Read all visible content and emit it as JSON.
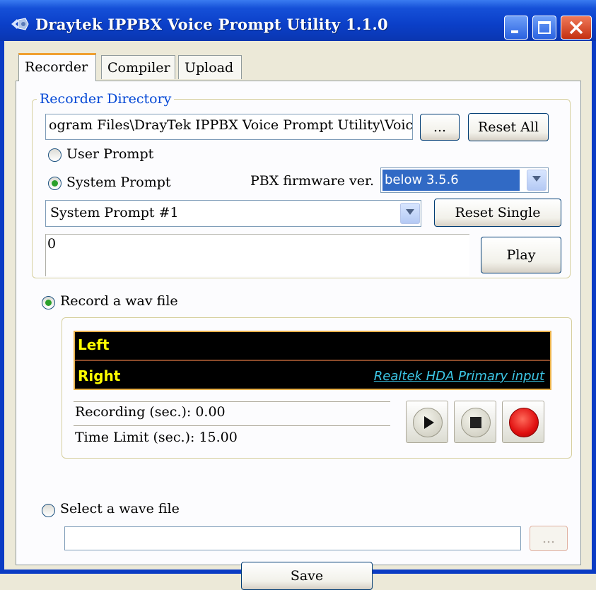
{
  "window": {
    "title": "Draytek IPPBX Voice Prompt Utility 1.1.0"
  },
  "tabs": [
    "Recorder",
    "Compiler",
    "Upload"
  ],
  "recorder_directory": {
    "legend": "Recorder Directory",
    "path": "ogram Files\\DrayTek IPPBX Voice Prompt Utility\\Voice",
    "browse_label": "...",
    "reset_all_label": "Reset All",
    "user_prompt_label": "User Prompt",
    "system_prompt_label": "System Prompt",
    "selected_prompt_type": "System Prompt",
    "firmware_label": "PBX firmware ver.",
    "firmware_value": "below 3.5.6",
    "prompt_select_value": "System Prompt #1",
    "reset_single_label": "Reset Single",
    "text_value": "0",
    "play_label": "Play"
  },
  "record": {
    "option_label": "Record a wav file",
    "selected": true,
    "left_label": "Left",
    "right_label": "Right",
    "input_source": "Realtek HDA Primary input",
    "recording_text": "Recording (sec.): 0.00",
    "time_limit_text": "Time Limit (sec.): 15.00"
  },
  "select_wave": {
    "option_label": "Select a wave file",
    "selected": false,
    "path": "",
    "browse_label": "..."
  },
  "save_label": "Save",
  "colors": {
    "title_bar": "#0a3bc4",
    "legend": "#0046d5",
    "meter_text": "#ffff00",
    "meter_link": "#3cc6e6"
  }
}
